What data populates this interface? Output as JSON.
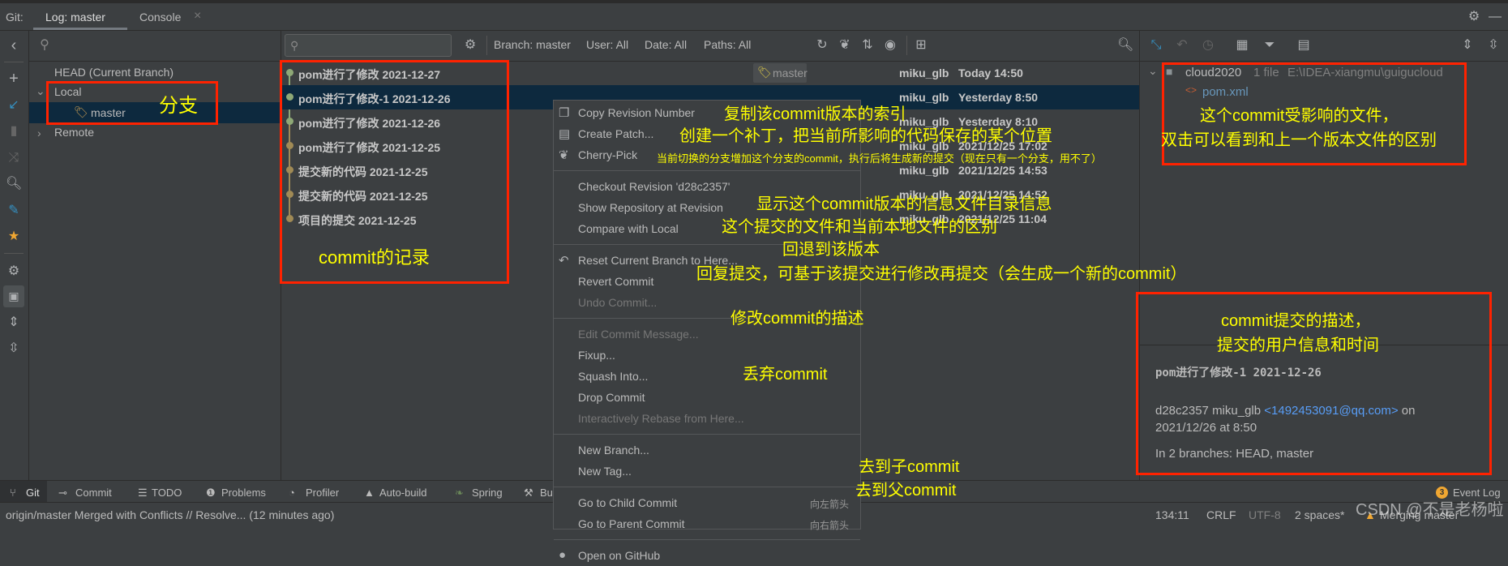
{
  "colors": {
    "accent": "#3592c4",
    "selection": "#0d293e",
    "annotation_text": "#ffff00",
    "annotation_box": "#ff2200",
    "graph_green": "#8ea876",
    "graph_brown": "#a08a55",
    "email_link": "#589df6",
    "badge": "#f0a732"
  },
  "tabbar": {
    "prefix": "Git:",
    "tabs": [
      {
        "label": "Log: master",
        "active": true
      },
      {
        "label": "Console",
        "closable": true
      }
    ],
    "close_icon": "×",
    "settings_icon": "gear-icon",
    "minimize_icon": "minus-icon"
  },
  "left_toolbar": {
    "icons": [
      "chevron-left-icon",
      "plus-icon",
      "update-arrow-icon",
      "trash-icon",
      "merge-icon",
      "search-icon",
      "edit-icon",
      "star-icon",
      "gear-icon",
      "preview-icon",
      "expand-all-icon",
      "collapse-all-icon"
    ]
  },
  "branches": {
    "search_placeholder": "",
    "items": [
      {
        "label": "HEAD (Current Branch)"
      },
      {
        "label": "Local",
        "expanded": true
      },
      {
        "label": "master",
        "selected": true
      },
      {
        "label": "Remote",
        "expanded": false
      }
    ]
  },
  "log_toolbar": {
    "search_placeholder": "",
    "filters": [
      "Branch: master",
      "User: All",
      "Date: All",
      "Paths: All"
    ]
  },
  "commits": [
    {
      "message": "pom进行了修改 2021-12-27",
      "tag": "master",
      "author": "miku_glb",
      "date": "Today 14:50",
      "color": "green"
    },
    {
      "message": "pom进行了修改-1 2021-12-26",
      "author": "miku_glb",
      "date": "Yesterday 8:50",
      "color": "green",
      "selected": true
    },
    {
      "message": "pom进行了修改 2021-12-26",
      "author": "miku_glb",
      "date": "Yesterday 8:10",
      "color": "green"
    },
    {
      "message": "pom进行了修改 2021-12-25",
      "author": "miku_glb",
      "date": "2021/12/25 17:02",
      "color": "brown"
    },
    {
      "message": "提交新的代码 2021-12-25",
      "author": "miku_glb",
      "date": "2021/12/25 14:53",
      "color": "brown"
    },
    {
      "message": "提交新的代码 2021-12-25",
      "author": "miku_glb",
      "date": "2021/12/25 14:52",
      "color": "brown"
    },
    {
      "message": "项目的提交 2021-12-25",
      "author": "miku_glb",
      "date": "2021/12/25 11:04",
      "color": "brown"
    }
  ],
  "context_menu": {
    "items": [
      {
        "label": "Copy Revision Number",
        "icon": "copy-icon"
      },
      {
        "label": "Create Patch...",
        "icon": "patch-icon"
      },
      {
        "label": "Cherry-Pick",
        "icon": "cherry-icon"
      },
      {
        "sep": true
      },
      {
        "label": "Checkout Revision 'd28c2357'"
      },
      {
        "label": "Show Repository at Revision"
      },
      {
        "label": "Compare with Local"
      },
      {
        "sep": true
      },
      {
        "label": "Reset Current Branch to Here...",
        "icon": "undo-icon"
      },
      {
        "label": "Revert Commit"
      },
      {
        "label": "Undo Commit...",
        "disabled": true
      },
      {
        "sep": true
      },
      {
        "label": "Edit Commit Message...",
        "disabled": true
      },
      {
        "label": "Fixup..."
      },
      {
        "label": "Squash Into..."
      },
      {
        "label": "Drop Commit"
      },
      {
        "label": "Interactively Rebase from Here...",
        "disabled": true
      },
      {
        "sep": true
      },
      {
        "label": "New Branch..."
      },
      {
        "label": "New Tag..."
      },
      {
        "sep": true
      },
      {
        "label": "Go to Child Commit",
        "shortcut": "向左箭头"
      },
      {
        "label": "Go to Parent Commit",
        "shortcut": "向右箭头"
      },
      {
        "sep": true
      },
      {
        "label": "Open on GitHub",
        "icon": "github-icon"
      }
    ]
  },
  "changes": {
    "root": "cloud2020",
    "count": "1 file",
    "path": "E:\\IDEA-xiangmu\\guigucloud",
    "file": "pom.xml"
  },
  "details": {
    "title": "pom进行了修改-1 2021-12-26",
    "hash_author": "d28c2357 miku_glb",
    "email": "<1492453091@qq.com>",
    "on": "on",
    "date": "2021/12/26 at 8:50",
    "branches": "In 2 branches: HEAD, master"
  },
  "bottom_tabs": [
    "Git",
    "Commit",
    "TODO",
    "Problems",
    "Profiler",
    "Auto-build",
    "Spring",
    "Bu"
  ],
  "event_log": {
    "count": "3",
    "label": "Event Log"
  },
  "status": {
    "message": "origin/master Merged with Conflicts // Resolve... (12 minutes ago)",
    "position": "134:11",
    "line_sep": "CRLF",
    "encoding": "UTF-8",
    "indent": "2 spaces*",
    "branch": "Merging master"
  },
  "watermark": "CSDN @不是老杨啦",
  "annotations": {
    "branch": "分支",
    "commit_log": "commit的记录",
    "copy": "复制该commit版本的索引",
    "patch": "创建一个补丁，把当前所影响的代码保存的某个位置",
    "cherry": "当前切换的分支增加这个分支的commit，执行后将生成新的提交（现在只有一个分支，用不了）",
    "show_repo": "显示这个commit版本的信息文件目录信息",
    "compare": "这个提交的文件和当前本地文件的区别",
    "reset": "回退到该版本",
    "revert": "回复提交，可基于该提交进行修改再提交（会生成一个新的commit）",
    "edit": "修改commit的描述",
    "drop": "丢弃commit",
    "child": "去到子commit",
    "parent": "去到父commit",
    "files_1": "这个commit受影响的文件，",
    "files_2": "双击可以看到和上一个版本文件的区别",
    "details_1": "commit提交的描述，",
    "details_2": "提交的用户信息和时间"
  }
}
